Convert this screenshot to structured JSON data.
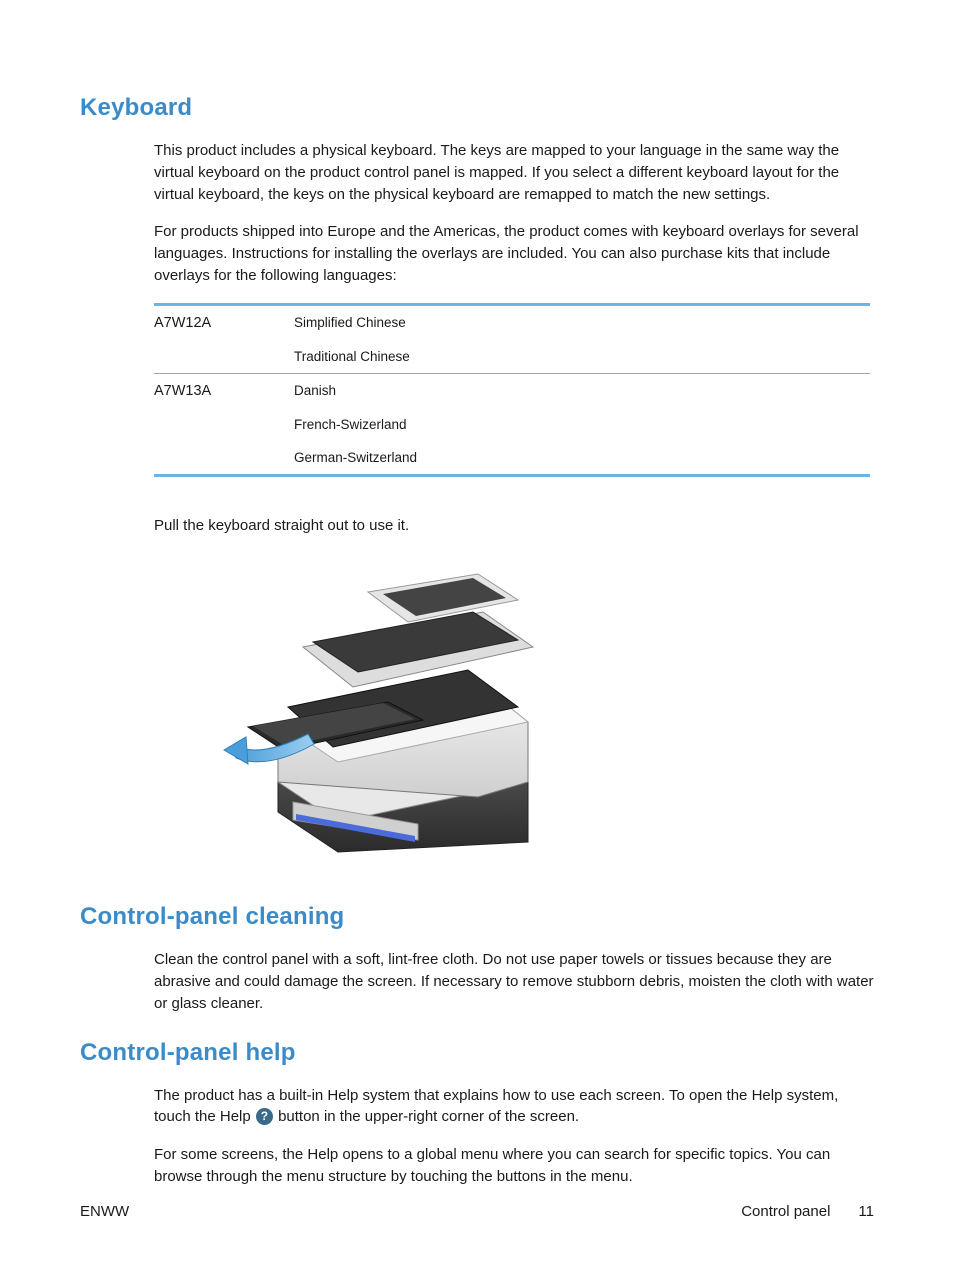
{
  "sections": {
    "keyboard": {
      "heading": "Keyboard",
      "para1": "This product includes a physical keyboard. The keys are mapped to your language in the same way the virtual keyboard on the product control panel is mapped. If you select a different keyboard layout for the virtual keyboard, the keys on the physical keyboard are remapped to match the new settings.",
      "para2": "For products shipped into Europe and the Americas, the product comes with keyboard overlays for several languages. Instructions for installing the overlays are included. You can also purchase kits that include overlays for the following languages:",
      "table": [
        {
          "code": "A7W12A",
          "langs": [
            "Simplified Chinese",
            "Traditional Chinese"
          ]
        },
        {
          "code": "A7W13A",
          "langs": [
            "Danish",
            "French-Swizerland",
            "German-Switzerland"
          ]
        }
      ],
      "para3": "Pull the keyboard straight out to use it."
    },
    "cleaning": {
      "heading": "Control-panel cleaning",
      "para1": "Clean the control panel with a soft, lint-free cloth. Do not use paper towels or tissues because they are abrasive and could damage the screen. If necessary to remove stubborn debris, moisten the cloth with water or glass cleaner."
    },
    "help": {
      "heading": "Control-panel help",
      "para1_a": "The product has a built-in Help system that explains how to use each screen. To open the Help system, touch the Help ",
      "para1_b": " button in the upper-right corner of the screen.",
      "help_icon_glyph": "?",
      "para2": "For some screens, the Help opens to a global menu where you can search for specific topics. You can browse through the menu structure by touching the buttons in the menu."
    }
  },
  "footer": {
    "left": "ENWW",
    "right_label": "Control panel",
    "page": "11"
  }
}
